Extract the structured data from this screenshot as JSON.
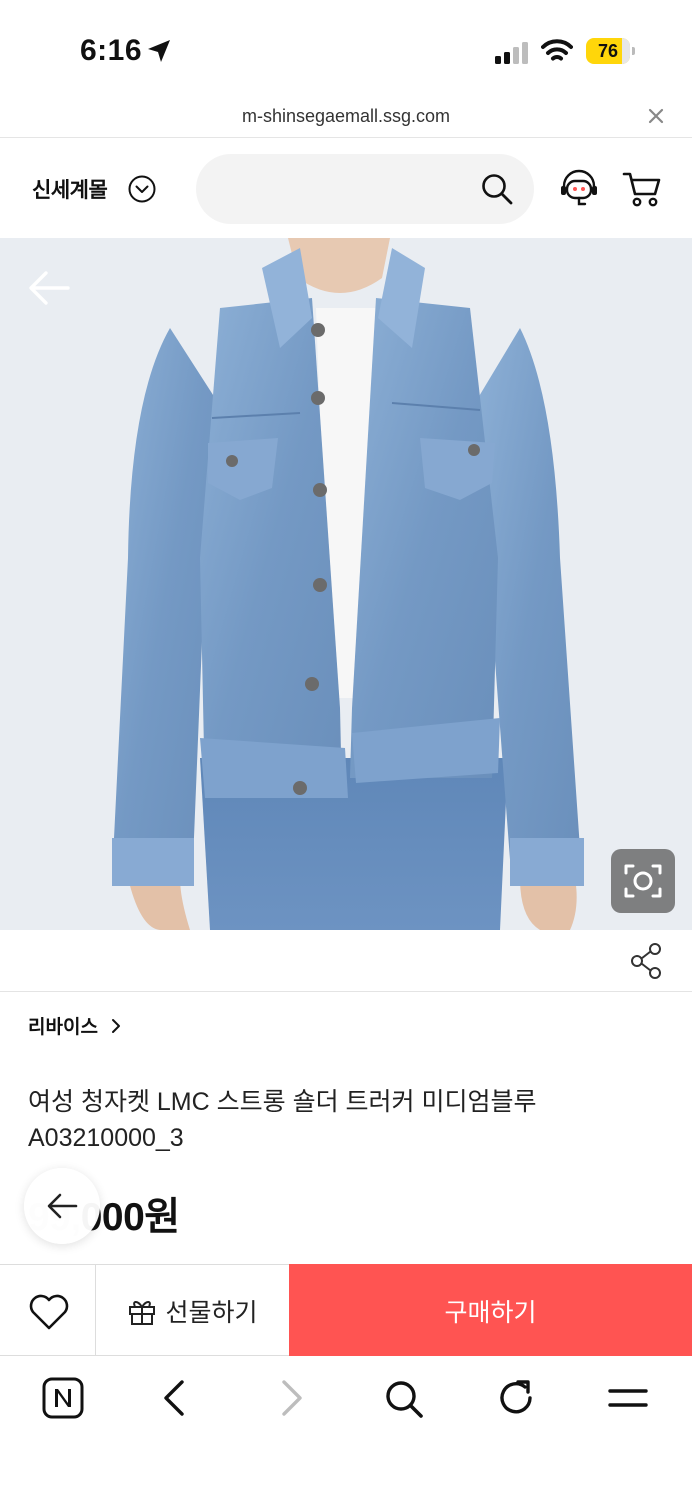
{
  "status_bar": {
    "time": "6:16",
    "battery_level": "76"
  },
  "url_bar": {
    "domain": "m-shinsegaemall.ssg.com"
  },
  "header": {
    "mall_name": "신세계몰"
  },
  "product": {
    "brand": "리바이스",
    "title": "여성 청자켓 LMC 스트롱 숄더 트러커 미디엄블루 A03210000_3",
    "price_visible": "000원"
  },
  "purchase_bar": {
    "gift_label": "선물하기",
    "buy_label": "구매하기"
  },
  "colors": {
    "buy_button": "#ff5452",
    "battery": "#ffd60a",
    "denim": "#7fa3cc"
  }
}
